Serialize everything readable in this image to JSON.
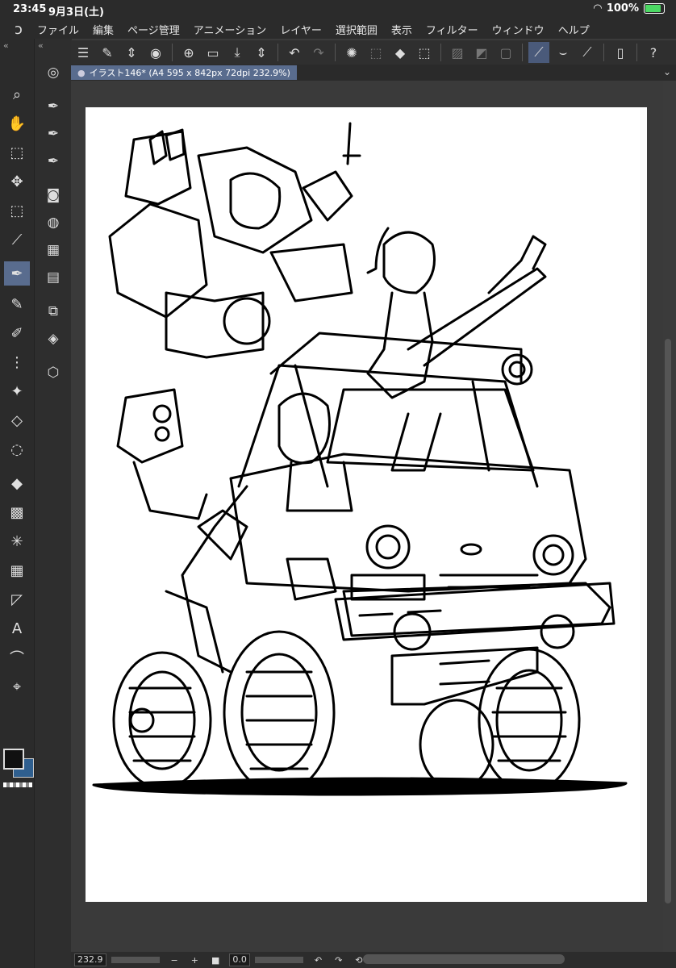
{
  "status": {
    "time": "23:45",
    "date": "9月3日(土)",
    "battery": "100%",
    "battery_level": 1.0
  },
  "menu": [
    "ファイル",
    "編集",
    "ページ管理",
    "アニメーション",
    "レイヤー",
    "選択範囲",
    "表示",
    "フィルター",
    "ウィンドウ",
    "ヘルプ"
  ],
  "tab": {
    "title": "イラスト146* (A4 595 x 842px 72dpi 232.9%)"
  },
  "bottom": {
    "zoom": "232.9",
    "angle": "0.0"
  },
  "colors": {
    "main": "#111111",
    "sub": "#2f5f8f",
    "accent": "#596c8e"
  },
  "tools": [
    "magnifier-icon",
    "hand-icon",
    "object-icon",
    "move-icon",
    "marquee-icon",
    "eyedropper-icon",
    "pen-icon",
    "pencil-icon",
    "brush-icon",
    "airbrush-icon",
    "decoration-icon",
    "eraser-icon",
    "blend-icon",
    "fill-icon",
    "gradient-icon",
    "figure-icon",
    "frame-icon",
    "ruler-icon",
    "text-icon",
    "balloon-icon",
    "correct-line-icon"
  ]
}
